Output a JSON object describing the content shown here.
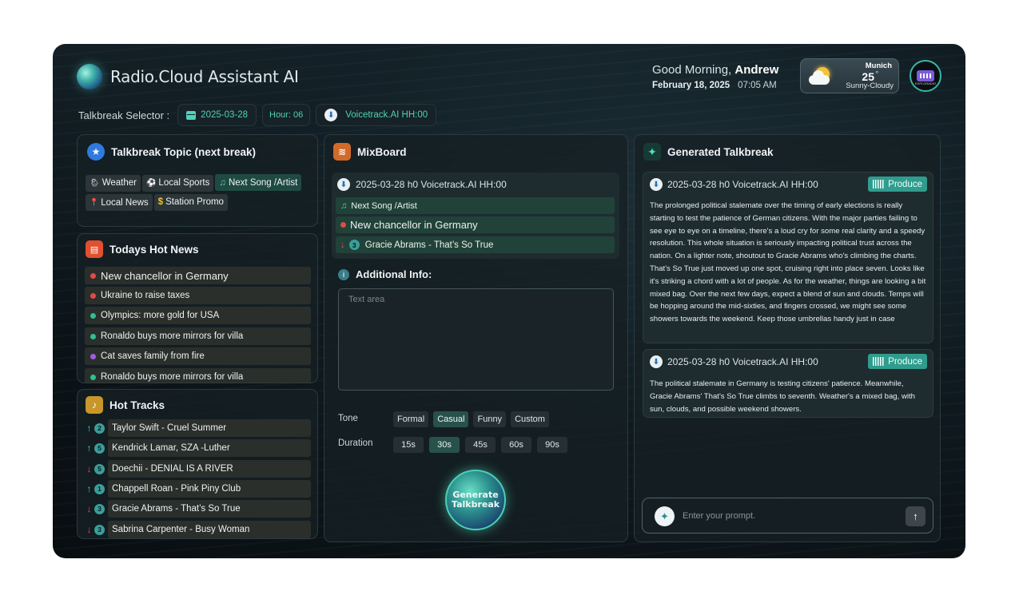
{
  "app": {
    "title": "Radio.Cloud Assistant AI"
  },
  "greeting": {
    "prefix": "Good Morning, ",
    "name": "Andrew",
    "date": "February 18, 2025",
    "time": "07:05 AM"
  },
  "weather": {
    "city": "Munich",
    "temp": "25",
    "unit": "°",
    "desc": "Sunny-Cloudy",
    "icon": "sun-cloud-icon"
  },
  "avatar": {
    "label": "EXPLORADIO"
  },
  "selector": {
    "label": "Talkbreak Selector :",
    "date": "2025-03-28",
    "hour": "Hour: 06",
    "voicetrack": "Voicetrack.AI HH:00"
  },
  "topic": {
    "title": "Talkbreak Topic (next break)",
    "tags": [
      {
        "label": "Weather",
        "icon": "🌦",
        "selected": false
      },
      {
        "label": "Local Sports",
        "icon": "⚽",
        "selected": false
      },
      {
        "label": "Next Song /Artist",
        "icon": "♫",
        "selected": true
      },
      {
        "label": "Local News",
        "icon": "📍",
        "selected": false
      },
      {
        "label": "Station Promo",
        "icon": "$",
        "selected": false
      }
    ]
  },
  "news": {
    "title": "Todays Hot News",
    "items": [
      {
        "label": "New chancellor in Germany",
        "color": "#e24a4a"
      },
      {
        "label": "Ukraine to raise taxes",
        "color": "#e24a4a"
      },
      {
        "label": "Olympics: more gold for USA",
        "color": "#2fc08f"
      },
      {
        "label": "Ronaldo buys more mirrors for villa",
        "color": "#2fc08f"
      },
      {
        "label": "Cat saves family from fire",
        "color": "#a55be0"
      },
      {
        "label": "Ronaldo buys more mirrors for villa",
        "color": "#2fc08f"
      }
    ]
  },
  "tracks": {
    "title": "Hot Tracks",
    "items": [
      {
        "dir": "↑",
        "rank": "2",
        "label": "Taylor Swift - Cruel Summer"
      },
      {
        "dir": "↑",
        "rank": "5",
        "label": "Kendrick Lamar, SZA -Luther"
      },
      {
        "dir": "↓",
        "rank": "5",
        "label": "Doechii - DENIAL IS A RIVER"
      },
      {
        "dir": "↑",
        "rank": "1",
        "label": "Chappell Roan - Pink Piny Club"
      },
      {
        "dir": "↓",
        "rank": "3",
        "label": "Gracie Abrams - That’s So True"
      },
      {
        "dir": "↓",
        "rank": "3",
        "label": "Sabrina Carpenter - Busy Woman"
      }
    ]
  },
  "mixboard": {
    "title": "MixBoard",
    "header": "2025-03-28 h0 Voicetrack.AI HH:00",
    "rows": [
      "Next Song /Artist",
      "New chancellor in Germany",
      "Gracie Abrams - That’s So True"
    ],
    "row3_rank": "3",
    "additional_info": "Additional Info:",
    "textarea_placeholder": "Text area",
    "tone_label": "Tone",
    "tones": [
      "Formal",
      "Casual",
      "Funny",
      "Custom"
    ],
    "tone_selected": "Casual",
    "duration_label": "Duration",
    "durations": [
      "15s",
      "30s",
      "45s",
      "60s",
      "90s"
    ],
    "duration_selected": "30s",
    "generate": "Generate Talkbreak"
  },
  "generated": {
    "title": "Generated Talkbreak",
    "cards": [
      {
        "header": "2025-03-28 h0 Voicetrack.AI HH:00",
        "action": "Produce",
        "text": "The prolonged political stalemate over the timing of early elections is really starting to test the patience of German citizens. With the major parties failing to see eye to eye on a timeline, there's a loud cry for some real clarity and a speedy resolution. This whole situation is seriously impacting political trust across the nation. On a lighter note, shoutout to Gracie Abrams who's climbing the charts. That's So True just moved up one spot, cruising right into place seven. Looks like it's striking a chord with a lot of people. As for the weather, things are looking a bit mixed bag. Over the next few days, expect a blend of sun and clouds. Temps will be hopping around the mid-sixties, and fingers crossed, we might see some showers towards the weekend. Keep those umbrellas handy just in case"
      },
      {
        "header": "2025-03-28 h0 Voicetrack.AI HH:00",
        "action": "Produce",
        "text": "The political stalemate in Germany is testing citizens' patience. Meanwhile, Gracie Abrams' That's So True climbs to seventh. Weather's a mixed bag, with sun, clouds, and possible weekend showers."
      }
    ],
    "prompt_placeholder": "Enter your prompt."
  },
  "colors": {
    "accent": "#4fd1b8",
    "produce": "#2f9c8e",
    "selected": "#28514a"
  }
}
